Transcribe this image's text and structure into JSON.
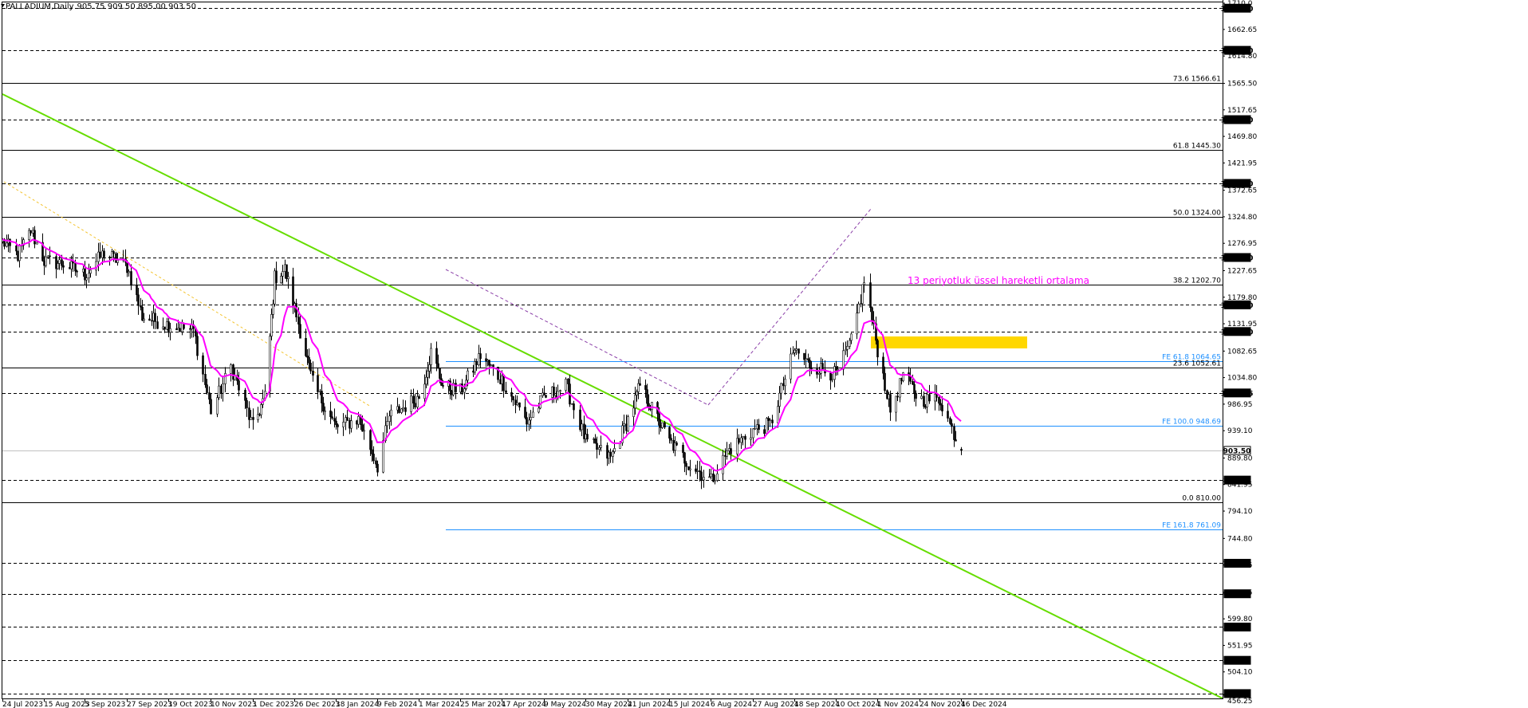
{
  "header": {
    "symbol_line": "PALLADIUM,Daily",
    "ohlc": "905.75 909.50 895.00 903.50"
  },
  "price_axis_ticks": [
    "1710.0",
    "1662.65",
    "1614.80",
    "1565.50",
    "1517.65",
    "1469.80",
    "1421.95",
    "1372.65",
    "1324.80",
    "1276.95",
    "1227.65",
    "1179.80",
    "1131.95",
    "1082.65",
    "1034.80",
    "986.95",
    "939.10",
    "889.80",
    "841.95",
    "794.10",
    "744.80",
    "696.95",
    "647.65",
    "599.80",
    "551.95",
    "504.10"
  ],
  "price_axis_bottom": "456.25",
  "boxed_levels": [
    {
      "value": 1701.0,
      "label": "1701.00"
    },
    {
      "value": 1625.0,
      "label": "1625.00"
    },
    {
      "value": 1500.0,
      "label": "1500.00"
    },
    {
      "value": 1385.0,
      "label": "1385.00"
    },
    {
      "value": 1251.4,
      "label": "1251.40"
    },
    {
      "value": 1166.0,
      "label": "1166.00"
    },
    {
      "value": 1117.9,
      "label": "1117.90"
    },
    {
      "value": 1007.15,
      "label": "1007.15"
    },
    {
      "value": 903.5,
      "label": "903.50",
      "current": true
    },
    {
      "value": 850.0,
      "label": "850.00"
    },
    {
      "value": 700.0,
      "label": "700.00"
    },
    {
      "value": 645.0,
      "label": "645.00"
    },
    {
      "value": 585.0,
      "label": "585.00"
    },
    {
      "value": 525.0,
      "label": "525.00"
    },
    {
      "value": 465.0,
      "label": "465.00"
    }
  ],
  "fib_levels": [
    {
      "value": 1566.61,
      "label": "73.6 1566.61"
    },
    {
      "value": 1445.3,
      "label": "61.8 1445.30"
    },
    {
      "value": 1324.0,
      "label": "50.0 1324.00"
    },
    {
      "value": 1202.7,
      "label": "38.2 1202.70"
    },
    {
      "value": 1052.61,
      "label": "23.6 1052.61"
    },
    {
      "value": 810.0,
      "label": "0.0 810.00"
    }
  ],
  "fe_levels": [
    {
      "value": 1064.65,
      "label": "FE 61.8 1064.65"
    },
    {
      "value": 948.69,
      "label": "FE 100.0 948.69"
    },
    {
      "value": 761.09,
      "label": "FE 161.8 761.09"
    }
  ],
  "date_labels": [
    "24 Jul 2023",
    "15 Aug 2023",
    "5 Sep 2023",
    "27 Sep 2023",
    "19 Oct 2023",
    "10 Nov 2023",
    "1 Dec 2023",
    "26 Dec 2023",
    "18 Jan 2024",
    "9 Feb 2024",
    "1 Mar 2024",
    "25 Mar 2024",
    "17 Apr 2024",
    "9 May 2024",
    "30 May 2024",
    "21 Jun 2024",
    "15 Jul 2024",
    "6 Aug 2024",
    "27 Aug 2024",
    "18 Sep 2024",
    "10 Oct 2024",
    "1 Nov 2024",
    "24 Nov 2024",
    "16 Dec 2024"
  ],
  "ema_note": "13 periyotluk üssel hareketli ortalama",
  "colors": {
    "candle": "#000000",
    "ema": "#ff00ff",
    "trendline": "#66dd00",
    "fe_line": "#1e90ff",
    "zone": "#ffd700",
    "fib_line": "#000000",
    "boxed_dash": "#000000",
    "current_line": "#c0c0c0"
  },
  "chart_data": {
    "type": "candlestick",
    "symbol": "PALLADIUM",
    "timeframe": "Daily",
    "last_bar": {
      "open": 905.75,
      "high": 909.5,
      "low": 895.0,
      "close": 903.5
    },
    "x_range": [
      "24 Jul 2023",
      "16 Dec 2024"
    ],
    "ylim": [
      456.25,
      1710.0
    ],
    "price_path": [
      {
        "date": "24 Jul 2023",
        "close": 1280
      },
      {
        "date": "1 Aug 2023",
        "close": 1255
      },
      {
        "date": "8 Aug 2023",
        "close": 1300
      },
      {
        "date": "15 Aug 2023",
        "close": 1245
      },
      {
        "date": "25 Aug 2023",
        "close": 1240
      },
      {
        "date": "5 Sep 2023",
        "close": 1220
      },
      {
        "date": "15 Sep 2023",
        "close": 1260
      },
      {
        "date": "27 Sep 2023",
        "close": 1235
      },
      {
        "date": "5 Oct 2023",
        "close": 1145
      },
      {
        "date": "19 Oct 2023",
        "close": 1130
      },
      {
        "date": "1 Nov 2023",
        "close": 1120
      },
      {
        "date": "10 Nov 2023",
        "close": 975
      },
      {
        "date": "20 Nov 2023",
        "close": 1055
      },
      {
        "date": "1 Dec 2023",
        "close": 945
      },
      {
        "date": "8 Dec 2023",
        "close": 1000
      },
      {
        "date": "14 Dec 2023",
        "close": 1215
      },
      {
        "date": "20 Dec 2023",
        "close": 1230
      },
      {
        "date": "26 Dec 2023",
        "close": 1160
      },
      {
        "date": "5 Jan 2024",
        "close": 1025
      },
      {
        "date": "18 Jan 2024",
        "close": 945
      },
      {
        "date": "30 Jan 2024",
        "close": 960
      },
      {
        "date": "9 Feb 2024",
        "close": 875
      },
      {
        "date": "15 Feb 2024",
        "close": 965
      },
      {
        "date": "1 Mar 2024",
        "close": 1000
      },
      {
        "date": "8 Mar 2024",
        "close": 1080
      },
      {
        "date": "15 Mar 2024",
        "close": 1020
      },
      {
        "date": "25 Mar 2024",
        "close": 1010
      },
      {
        "date": "5 Apr 2024",
        "close": 1075
      },
      {
        "date": "17 Apr 2024",
        "close": 1030
      },
      {
        "date": "30 Apr 2024",
        "close": 955
      },
      {
        "date": "9 May 2024",
        "close": 1000
      },
      {
        "date": "20 May 2024",
        "close": 1020
      },
      {
        "date": "30 May 2024",
        "close": 920
      },
      {
        "date": "12 Jun 2024",
        "close": 890
      },
      {
        "date": "21 Jun 2024",
        "close": 960
      },
      {
        "date": "28 Jun 2024",
        "close": 1020
      },
      {
        "date": "15 Jul 2024",
        "close": 920
      },
      {
        "date": "25 Jul 2024",
        "close": 880
      },
      {
        "date": "6 Aug 2024",
        "close": 850
      },
      {
        "date": "15 Aug 2024",
        "close": 905
      },
      {
        "date": "27 Aug 2024",
        "close": 940
      },
      {
        "date": "5 Sep 2024",
        "close": 950
      },
      {
        "date": "18 Sep 2024",
        "close": 1085
      },
      {
        "date": "25 Sep 2024",
        "close": 1060
      },
      {
        "date": "10 Oct 2024",
        "close": 1040
      },
      {
        "date": "18 Oct 2024",
        "close": 1100
      },
      {
        "date": "25 Oct 2024",
        "close": 1210
      },
      {
        "date": "1 Nov 2024",
        "close": 1085
      },
      {
        "date": "8 Nov 2024",
        "close": 975
      },
      {
        "date": "15 Nov 2024",
        "close": 1040
      },
      {
        "date": "24 Nov 2024",
        "close": 995
      },
      {
        "date": "5 Dec 2024",
        "close": 995
      },
      {
        "date": "10 Dec 2024",
        "close": 950
      },
      {
        "date": "16 Dec 2024",
        "close": 903.5
      }
    ],
    "ema_period": 13
  }
}
